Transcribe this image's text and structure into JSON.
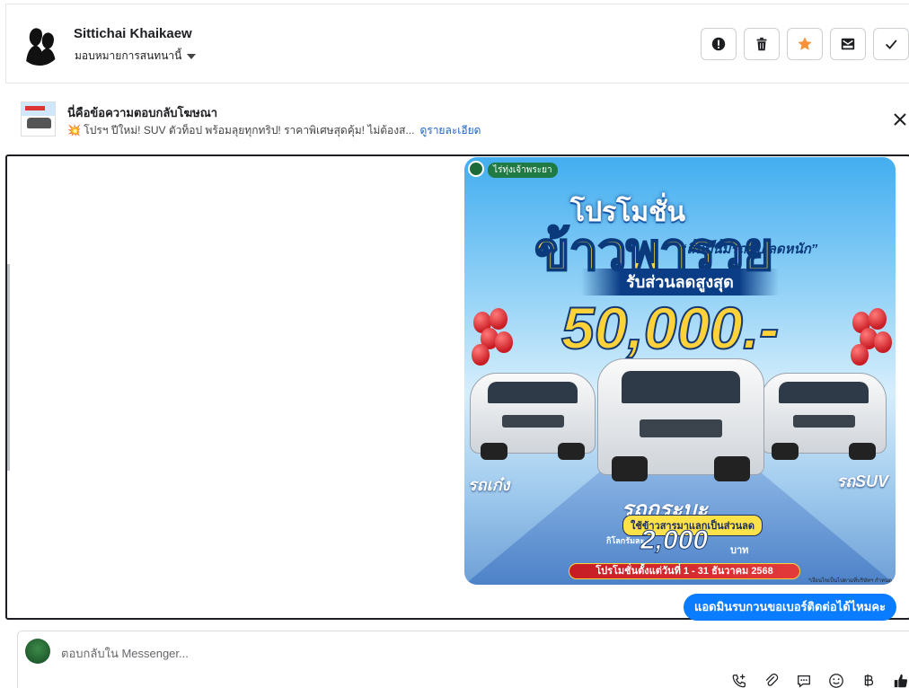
{
  "header": {
    "contact_name": "Sittichai Khaikaew",
    "assign_label": "มอบหมายการสนทนานี้",
    "actions": [
      {
        "name": "report-spam-button",
        "icon": "exclamation-circle-icon"
      },
      {
        "name": "delete-button",
        "icon": "trash-icon"
      },
      {
        "name": "star-button",
        "icon": "star-icon",
        "color": "#f7923b"
      },
      {
        "name": "mark-unread-button",
        "icon": "envelope-icon"
      },
      {
        "name": "mark-done-button",
        "icon": "check-icon"
      }
    ]
  },
  "ad_reply": {
    "title": "นี่คือข้อความตอบกลับโฆษณา",
    "snippet": "💥 โปรฯ ปีใหม่! SUV ตัวท็อป พร้อมลุยทุกทริป! ราคาพิเศษสุดคุ้ม! ไม่ต้องส...",
    "details_link": "ดูรายละเอียด"
  },
  "promo_image": {
    "brand": "ไร่ทุ่งเจ้าพระยา",
    "title_top": "โปรโมชั่น",
    "title_main": "ข้าวพารวย",
    "tagline": "“สิ้นปีนี้มีรถขับ ลดหนัก”",
    "discount_label": "รับส่วนลดสูงสุด",
    "discount_amount": "50,000.-",
    "sedan_label": "รถเก๋ง",
    "suv_label": "รถSUV",
    "pickup_label": "รถกระบะ",
    "rice_offer": "ใช้ข้าวสารมาแลกเป็นส่วนลด",
    "per_kg": "กิโลกรัมละ",
    "per_kg_amount": "2,000",
    "baht": "บาท",
    "period": "โปรโมชั่นตั้งแต่วันที่ 1 - 31 ธันวาคม 2568",
    "fineprint": "*เงื่อนไขเป็นไปตามที่บริษัทฯ กำหนด"
  },
  "messages": [
    {
      "text": "แอดมินรบกวนขอเบอร์ติดต่อได้ไหมคะ",
      "color": "#0a7cff"
    }
  ],
  "composer": {
    "placeholder": "ตอบกลับใน Messenger...",
    "tools": [
      "call-plus-icon",
      "paperclip-icon",
      "saved-reply-icon",
      "emoji-icon",
      "baht-icon",
      "thumbs-up-icon"
    ]
  }
}
